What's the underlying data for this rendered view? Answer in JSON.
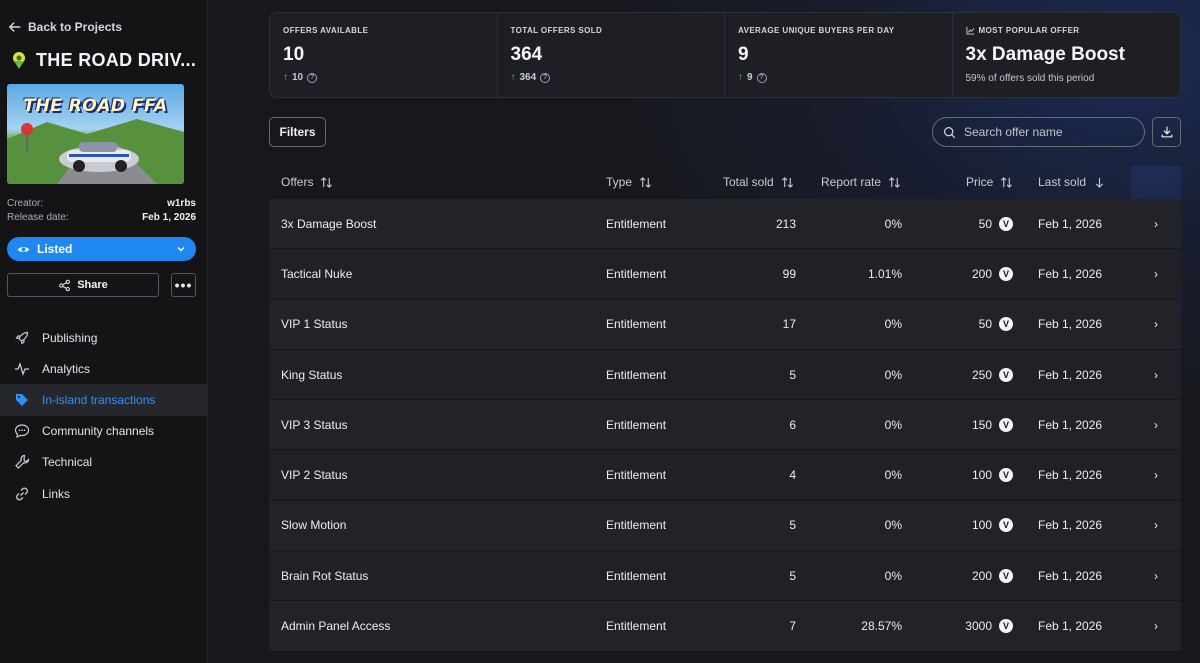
{
  "sidebar": {
    "back_label": "Back to Projects",
    "project_title": "THE ROAD DRIV...",
    "thumbnail_text": "THE ROAD FFA",
    "creator_key": "Creator:",
    "creator_value": "w1rbs",
    "release_key": "Release date:",
    "release_value": "Feb 1, 2026",
    "status_label": "Listed",
    "share_label": "Share",
    "more_label": "•••",
    "nav": [
      {
        "label": "Publishing",
        "icon": "rocket-icon"
      },
      {
        "label": "Analytics",
        "icon": "pulse-icon"
      },
      {
        "label": "In-island transactions",
        "icon": "tag-icon"
      },
      {
        "label": "Community channels",
        "icon": "chat-icon"
      },
      {
        "label": "Technical",
        "icon": "wrench-icon"
      },
      {
        "label": "Links",
        "icon": "link-icon"
      }
    ]
  },
  "stats": [
    {
      "label": "OFFERS AVAILABLE",
      "value": "10",
      "delta": "10"
    },
    {
      "label": "TOTAL OFFERS SOLD",
      "value": "364",
      "delta": "364"
    },
    {
      "label": "AVERAGE UNIQUE BUYERS PER DAY",
      "value": "9",
      "delta": "9"
    },
    {
      "label": "MOST POPULAR OFFER",
      "value": "3x Damage Boost",
      "note": "59% of offers sold this period"
    }
  ],
  "toolbar": {
    "filters_label": "Filters",
    "search_placeholder": "Search offer name"
  },
  "table": {
    "columns": [
      "Offers",
      "Type",
      "Total sold",
      "Report rate",
      "Price",
      "Last sold"
    ],
    "currency_symbol": "V",
    "rows": [
      {
        "name": "3x Damage Boost",
        "type": "Entitlement",
        "sold": "213",
        "rate": "0%",
        "price": "50",
        "date": "Feb 1, 2026"
      },
      {
        "name": "Tactical Nuke",
        "type": "Entitlement",
        "sold": "99",
        "rate": "1.01%",
        "price": "200",
        "date": "Feb 1, 2026"
      },
      {
        "name": "VIP 1 Status",
        "type": "Entitlement",
        "sold": "17",
        "rate": "0%",
        "price": "50",
        "date": "Feb 1, 2026"
      },
      {
        "name": "King Status",
        "type": "Entitlement",
        "sold": "5",
        "rate": "0%",
        "price": "250",
        "date": "Feb 1, 2026"
      },
      {
        "name": "VIP 3 Status",
        "type": "Entitlement",
        "sold": "6",
        "rate": "0%",
        "price": "150",
        "date": "Feb 1, 2026"
      },
      {
        "name": "VIP 2 Status",
        "type": "Entitlement",
        "sold": "4",
        "rate": "0%",
        "price": "100",
        "date": "Feb 1, 2026"
      },
      {
        "name": "Slow Motion",
        "type": "Entitlement",
        "sold": "5",
        "rate": "0%",
        "price": "100",
        "date": "Feb 1, 2026"
      },
      {
        "name": "Brain Rot Status",
        "type": "Entitlement",
        "sold": "5",
        "rate": "0%",
        "price": "200",
        "date": "Feb 1, 2026"
      },
      {
        "name": "Admin Panel Access",
        "type": "Entitlement",
        "sold": "7",
        "rate": "28.57%",
        "price": "3000",
        "date": "Feb 1, 2026"
      }
    ]
  },
  "colors": {
    "accent": "#1f87f2",
    "positive": "#3ecf6e"
  }
}
